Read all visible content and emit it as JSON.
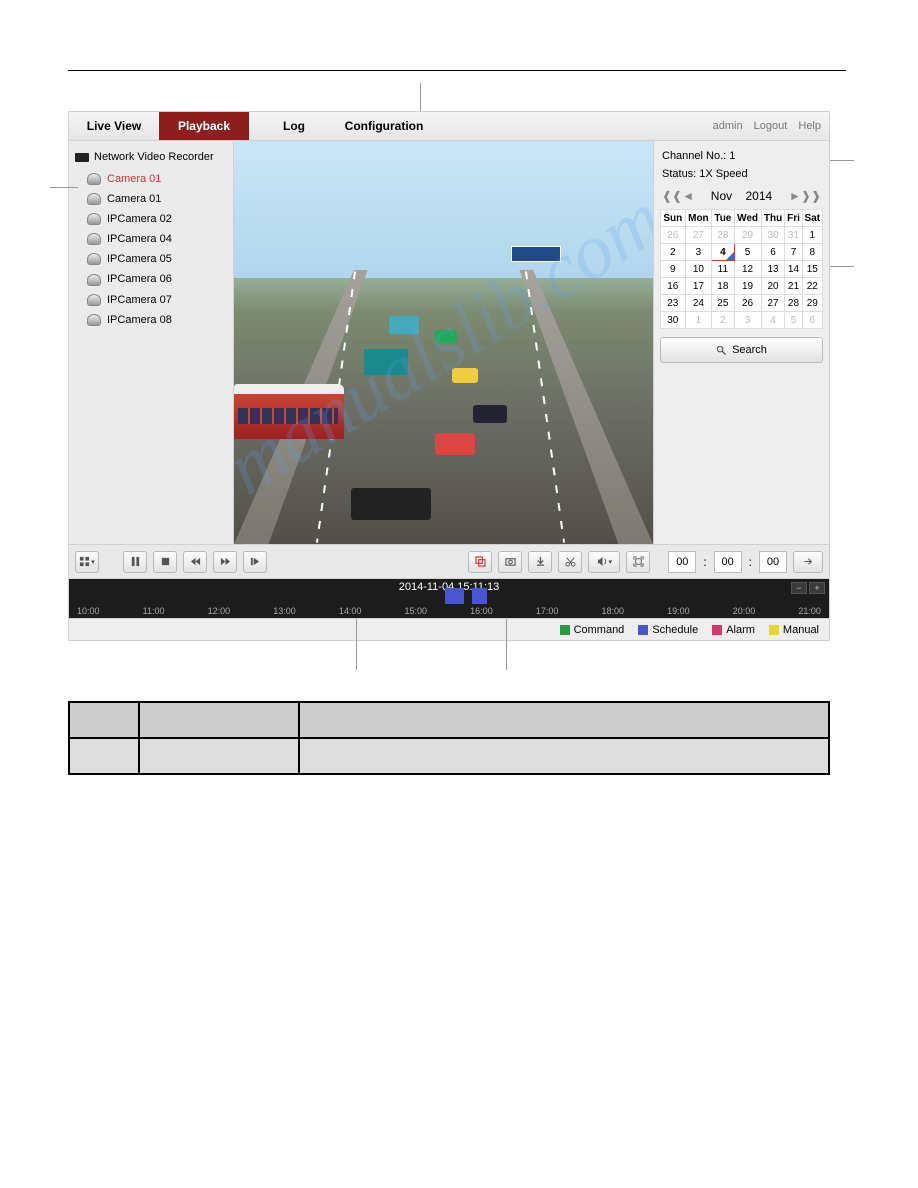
{
  "tabs": {
    "live": "Live View",
    "playback": "Playback",
    "log": "Log",
    "config": "Configuration"
  },
  "user": {
    "name": "admin",
    "logout": "Logout",
    "help": "Help"
  },
  "sidebar": {
    "title": "Network Video Recorder",
    "items": [
      "Camera 01",
      "Camera 01",
      "IPCamera 02",
      "IPCamera 04",
      "IPCamera 05",
      "IPCamera 06",
      "IPCamera 07",
      "IPCamera 08"
    ]
  },
  "status": {
    "channel": "Channel No.: 1",
    "speed": "Status: 1X Speed"
  },
  "calendar": {
    "month": "Nov",
    "year": "2014",
    "days": [
      "Sun",
      "Mon",
      "Tue",
      "Wed",
      "Thu",
      "Fri",
      "Sat"
    ],
    "prev": [
      "26",
      "27",
      "28",
      "29",
      "30",
      "31"
    ],
    "cur": [
      "1",
      "2",
      "3",
      "4",
      "5",
      "6",
      "7",
      "8",
      "9",
      "10",
      "11",
      "12",
      "13",
      "14",
      "15",
      "16",
      "17",
      "18",
      "19",
      "20",
      "21",
      "22",
      "23",
      "24",
      "25",
      "26",
      "27",
      "28",
      "29",
      "30"
    ],
    "next": [
      "1",
      "2",
      "3",
      "4",
      "5",
      "6"
    ],
    "selected": "4"
  },
  "search": {
    "label": "Search"
  },
  "time": {
    "h": "00",
    "m": "00",
    "s": "00"
  },
  "timeline": {
    "timestamp": "2014-11-04 15:11:13",
    "ticks": [
      "10:00",
      "11:00",
      "12:00",
      "13:00",
      "14:00",
      "15:00",
      "16:00",
      "17:00",
      "18:00",
      "19:00",
      "20:00",
      "21:00"
    ]
  },
  "legend": {
    "command": "Command",
    "schedule": "Schedule",
    "alarm": "Alarm",
    "manual": "Manual"
  },
  "watermark": "manualslib.com"
}
